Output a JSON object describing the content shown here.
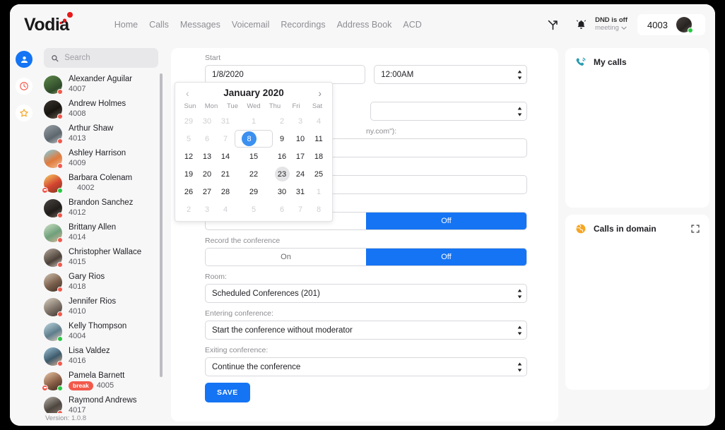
{
  "app": {
    "logo_text": "Vodia",
    "version": "Version: 1.0.8"
  },
  "topnav": [
    {
      "label": "Home"
    },
    {
      "label": "Calls"
    },
    {
      "label": "Messages"
    },
    {
      "label": "Voicemail"
    },
    {
      "label": "Recordings"
    },
    {
      "label": "Address Book"
    },
    {
      "label": "ACD"
    }
  ],
  "header_right": {
    "transfer_icon": "call-transfer-icon",
    "bell_icon": "bell-icon",
    "dnd_title": "DND is off",
    "dnd_sub": "meeting",
    "extension": "4003",
    "avatar": "user-avatar",
    "status": "online"
  },
  "rail": [
    {
      "name": "contacts",
      "icon": "person-icon",
      "active": true
    },
    {
      "name": "history",
      "icon": "clock-icon",
      "active": false
    },
    {
      "name": "favorites",
      "icon": "star-icon",
      "active": false
    }
  ],
  "search": {
    "placeholder": "Search",
    "value": "",
    "icon": "search-icon"
  },
  "contacts": [
    {
      "name": "Alexander Aguilar",
      "ext": "4007",
      "status": "busy",
      "dnd": false,
      "badge": ""
    },
    {
      "name": "Andrew Holmes",
      "ext": "4008",
      "status": "busy",
      "dnd": false,
      "badge": ""
    },
    {
      "name": "Arthur Shaw",
      "ext": "4013",
      "status": "busy",
      "dnd": false,
      "badge": ""
    },
    {
      "name": "Ashley Harrison",
      "ext": "4009",
      "status": "busy",
      "dnd": false,
      "badge": ""
    },
    {
      "name": "Barbara Colenam",
      "ext": "4002",
      "status": "online",
      "dnd": true,
      "badge": ""
    },
    {
      "name": "Brandon Sanchez",
      "ext": "4012",
      "status": "busy",
      "dnd": false,
      "badge": ""
    },
    {
      "name": "Brittany Allen",
      "ext": "4014",
      "status": "busy",
      "dnd": false,
      "badge": ""
    },
    {
      "name": "Christopher Wallace",
      "ext": "4015",
      "status": "busy",
      "dnd": false,
      "badge": ""
    },
    {
      "name": "Gary Rios",
      "ext": "4018",
      "status": "busy",
      "dnd": false,
      "badge": ""
    },
    {
      "name": "Jennifer Rios",
      "ext": "4010",
      "status": "busy",
      "dnd": false,
      "badge": ""
    },
    {
      "name": "Kelly Thompson",
      "ext": "4004",
      "status": "online",
      "dnd": false,
      "badge": ""
    },
    {
      "name": "Lisa Valdez",
      "ext": "4016",
      "status": "busy",
      "dnd": false,
      "badge": ""
    },
    {
      "name": "Pamela Barnett",
      "ext": "4005",
      "status": "online",
      "dnd": true,
      "badge": "break"
    },
    {
      "name": "Raymond Andrews",
      "ext": "4017",
      "status": "busy",
      "dnd": false,
      "badge": ""
    }
  ],
  "form": {
    "start_label": "Start",
    "start_date": "1/8/2020",
    "start_time": "12:00AM",
    "hidden_select_value": "",
    "participants_label_visible": "ny.com\"):",
    "record_label": "Record the conference",
    "toggle_on": "On",
    "toggle_off": "Off",
    "room_label": "Room:",
    "room_value": "Scheduled Conferences (201)",
    "entering_label": "Entering conference:",
    "entering_value": "Start the conference without moderator",
    "exiting_label": "Exiting conference:",
    "exiting_value": "Continue the conference",
    "save_label": "SAVE"
  },
  "calendar": {
    "title": "January 2020",
    "prev_icon": "chevron-left-icon",
    "next_icon": "chevron-right-icon",
    "dow": [
      "Sun",
      "Mon",
      "Tue",
      "Wed",
      "Thu",
      "Fri",
      "Sat"
    ],
    "selected_day": 8,
    "hovered_day": 23,
    "weeks": [
      [
        {
          "d": "29",
          "state": "muted"
        },
        {
          "d": "30",
          "state": "muted"
        },
        {
          "d": "31",
          "state": "muted"
        },
        {
          "d": "1",
          "state": "muted"
        },
        {
          "d": "2",
          "state": "muted"
        },
        {
          "d": "3",
          "state": "muted"
        },
        {
          "d": "4",
          "state": "muted"
        }
      ],
      [
        {
          "d": "5",
          "state": "muted"
        },
        {
          "d": "6",
          "state": "muted"
        },
        {
          "d": "7",
          "state": "muted"
        },
        {
          "d": "8",
          "state": "sel"
        },
        {
          "d": "9",
          "state": ""
        },
        {
          "d": "10",
          "state": ""
        },
        {
          "d": "11",
          "state": ""
        }
      ],
      [
        {
          "d": "12",
          "state": ""
        },
        {
          "d": "13",
          "state": ""
        },
        {
          "d": "14",
          "state": ""
        },
        {
          "d": "15",
          "state": ""
        },
        {
          "d": "16",
          "state": ""
        },
        {
          "d": "17",
          "state": ""
        },
        {
          "d": "18",
          "state": ""
        }
      ],
      [
        {
          "d": "19",
          "state": ""
        },
        {
          "d": "20",
          "state": ""
        },
        {
          "d": "21",
          "state": ""
        },
        {
          "d": "22",
          "state": ""
        },
        {
          "d": "23",
          "state": "hov"
        },
        {
          "d": "24",
          "state": ""
        },
        {
          "d": "25",
          "state": ""
        }
      ],
      [
        {
          "d": "26",
          "state": ""
        },
        {
          "d": "27",
          "state": ""
        },
        {
          "d": "28",
          "state": ""
        },
        {
          "d": "29",
          "state": ""
        },
        {
          "d": "30",
          "state": ""
        },
        {
          "d": "31",
          "state": ""
        },
        {
          "d": "1",
          "state": "muted"
        }
      ],
      [
        {
          "d": "2",
          "state": "muted"
        },
        {
          "d": "3",
          "state": "muted"
        },
        {
          "d": "4",
          "state": "muted"
        },
        {
          "d": "5",
          "state": "muted"
        },
        {
          "d": "6",
          "state": "muted"
        },
        {
          "d": "7",
          "state": "muted"
        },
        {
          "d": "8",
          "state": "muted"
        }
      ]
    ]
  },
  "right_panels": [
    {
      "title": "My calls",
      "icon": "phone-waves-icon",
      "icon_color": "#2a9bb0",
      "expandable": false
    },
    {
      "title": "Calls in domain",
      "icon": "globe-icon",
      "icon_color": "#f5a623",
      "expandable": true
    }
  ],
  "colors": {
    "accent_blue": "#1474f4",
    "status_busy": "#f2594b",
    "status_online": "#27c840",
    "logo_red": "#e8191a"
  }
}
